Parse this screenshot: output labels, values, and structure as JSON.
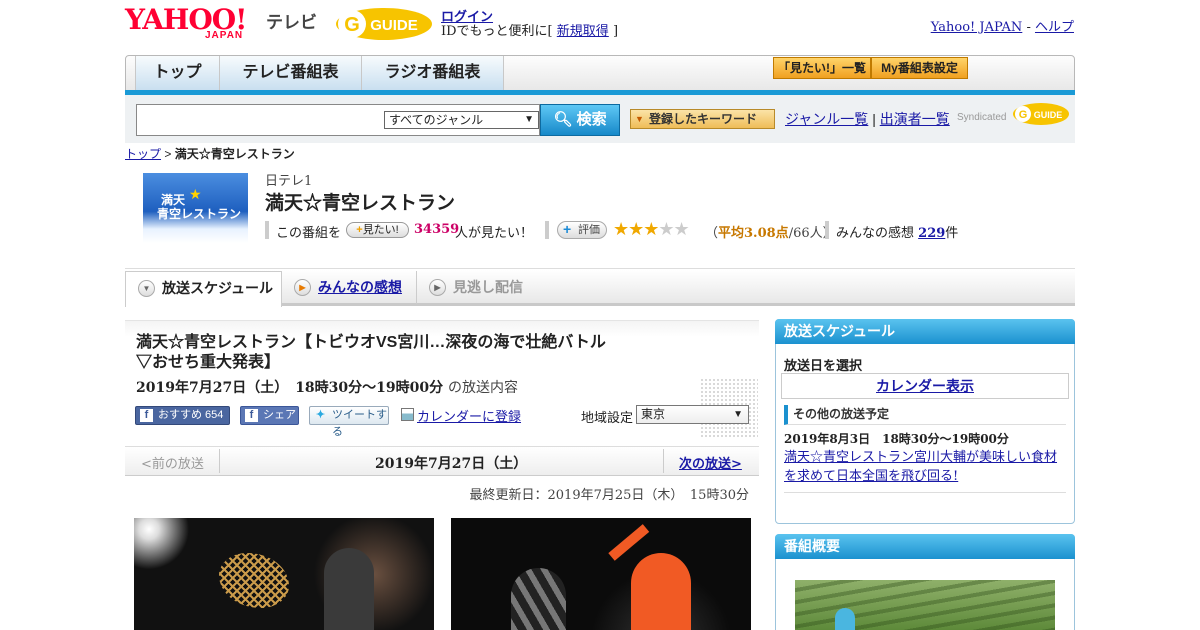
{
  "header": {
    "yahoo_logo": "YAHOO!",
    "japan_label": "JAPAN",
    "tv_label": "テレビ",
    "gguide_logo": "GUIDE",
    "login_link": "ログイン",
    "login_note_prefix": "IDでもっと便利に[",
    "signup_link": "新規取得",
    "login_note_suffix": "]",
    "yahoo_japan_link": "Yahoo! JAPAN",
    "separator": " - ",
    "help_link": "ヘルプ"
  },
  "nav": {
    "tabs": [
      "トップ",
      "テレビ番組表",
      "ラジオ番組表"
    ],
    "want_list_button": "「見たい!」一覧",
    "my_schedule_button": "My番組表設定"
  },
  "search": {
    "placeholder": "",
    "genre_selected": "すべてのジャンル",
    "search_button": "検索",
    "keyword_button": "登録したキーワード",
    "genre_list_link": "ジャンル一覧",
    "link_separator": "|",
    "performer_list_link": "出演者一覧",
    "syndicated_label": "Syndicated",
    "syndicated_logo": "GUIDE"
  },
  "breadcrumb": {
    "home": "トップ",
    "separator": " > ",
    "current": "満天☆青空レストラン"
  },
  "program": {
    "thumb_line1": "満天",
    "thumb_star": "★",
    "thumb_line2": "青空レストラン",
    "channel": "日テレ1",
    "title": "満天☆青空レストラン",
    "want_prefix": "この番組を",
    "want_button": "見たい!",
    "want_count": "34359",
    "want_suffix": "人が見たい！",
    "rate_button": "評価",
    "rating_value": 3.08,
    "stars_on": "★★★",
    "stars_off": "★★",
    "rate_avg_open": "（",
    "rate_avg_label": "平均3.08点",
    "rate_avg_count": "/66人）",
    "impressions_prefix": "みんなの感想",
    "impressions_count": "229",
    "impressions_suffix": "件"
  },
  "tabs": {
    "schedule": "放送スケジュール",
    "impressions": "みんなの感想",
    "catchup": "見逃し配信"
  },
  "episode": {
    "title": "満天☆青空レストラン【トビウオVS宮川…深夜の海で壮絶バトル▽おせち重大発表】",
    "date_time": "2019年7月27日（土）　18時30分～19時00分",
    "date_suffix": "の放送内容",
    "fb_recommend": "おすすめ 654",
    "fb_share": "シェア",
    "tweet": "ツイートする",
    "calendar_register": "カレンダーに登録",
    "region_label": "地域設定",
    "region_selected": "東京",
    "prev_link": "<前の放送",
    "nav_date": "2019年7月27日（土）",
    "next_link": "次の放送>",
    "last_updated": "最終更新日：2019年7月25日（木）　15時30分"
  },
  "sidebar": {
    "schedule_head": "放送スケジュール",
    "pick_date": "放送日を選択",
    "calendar_link": "カレンダー表示",
    "other_head": "その他の放送予定",
    "other_date": "2019年8月3日　18時30分～19時00分",
    "other_title": "満天☆青空レストラン宮川大輔が美味しい食材を求めて日本全国を飛び回る!",
    "summary_head": "番組概要"
  },
  "colors": {
    "accent_blue": "#1a9ad6",
    "yahoo_red": "#ff0033",
    "want_count": "#cc0066",
    "star": "#f0a800"
  }
}
